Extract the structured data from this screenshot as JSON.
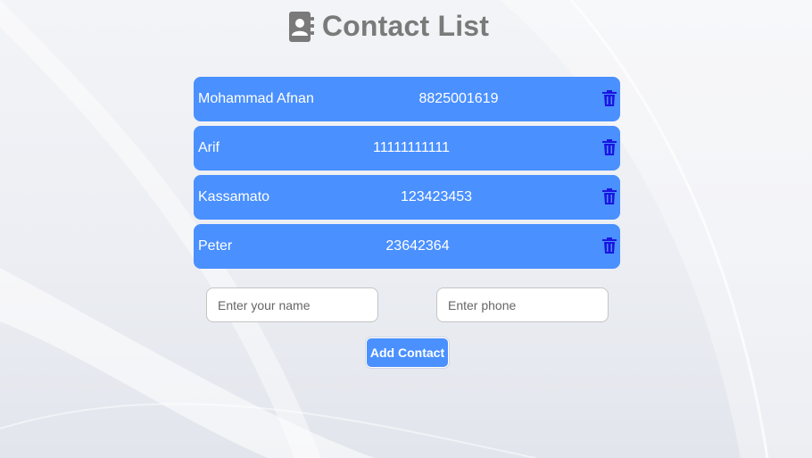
{
  "header": {
    "title": "Contact List",
    "icon": "address-book-icon"
  },
  "colors": {
    "accent": "#4a90ff",
    "trash": "#1a16e0",
    "title": "#7a7a7a"
  },
  "contacts": [
    {
      "name": "Mohammad Afnan",
      "phone": "8825001619"
    },
    {
      "name": "Arif",
      "phone": "11111111111"
    },
    {
      "name": "Kassamato",
      "phone": "123423453"
    },
    {
      "name": "Peter",
      "phone": "23642364"
    }
  ],
  "form": {
    "name_placeholder": "Enter your name",
    "phone_placeholder": "Enter phone",
    "add_label": "Add Contact"
  }
}
